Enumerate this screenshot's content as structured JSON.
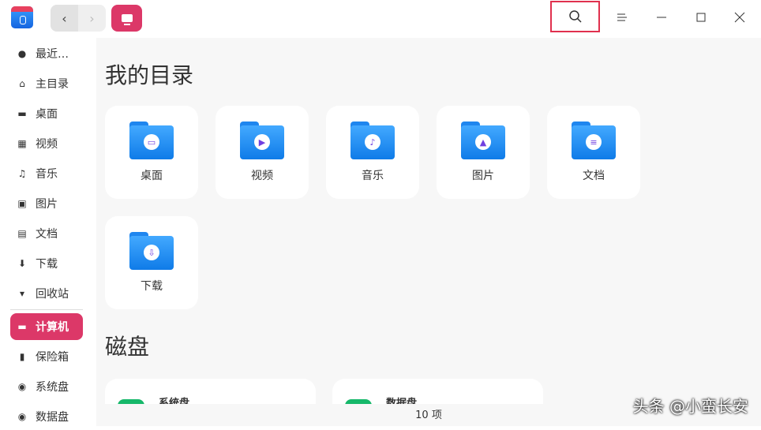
{
  "titlebar": {
    "back": "‹",
    "forward": "›"
  },
  "sidebar": {
    "items": [
      {
        "label": "最近…",
        "icon": "clock-icon",
        "glyph": "●"
      },
      {
        "label": "主目录",
        "icon": "home-icon",
        "glyph": "⌂"
      },
      {
        "label": "桌面",
        "icon": "desktop-icon",
        "glyph": "▬"
      },
      {
        "label": "视频",
        "icon": "video-icon",
        "glyph": "▦"
      },
      {
        "label": "音乐",
        "icon": "music-icon",
        "glyph": "♫"
      },
      {
        "label": "图片",
        "icon": "picture-icon",
        "glyph": "▣"
      },
      {
        "label": "文档",
        "icon": "document-icon",
        "glyph": "▤"
      },
      {
        "label": "下载",
        "icon": "download-icon",
        "glyph": "⬇"
      },
      {
        "label": "回收站",
        "icon": "trash-icon",
        "glyph": "▾"
      },
      {
        "label": "计算机",
        "icon": "computer-icon",
        "glyph": "▬"
      },
      {
        "label": "保险箱",
        "icon": "vault-icon",
        "glyph": "▮"
      },
      {
        "label": "系统盘",
        "icon": "disk-icon",
        "glyph": "◉"
      },
      {
        "label": "数据盘",
        "icon": "disk-icon",
        "glyph": "◉"
      }
    ]
  },
  "main": {
    "section_dirs": "我的目录",
    "folders": [
      {
        "label": "桌面",
        "glyph": "▭"
      },
      {
        "label": "视频",
        "glyph": "▶"
      },
      {
        "label": "音乐",
        "glyph": "♪"
      },
      {
        "label": "图片",
        "glyph": "▲"
      },
      {
        "label": "文档",
        "glyph": "≡"
      },
      {
        "label": "下载",
        "glyph": "⇩"
      }
    ],
    "section_disks": "磁盘",
    "disks": [
      {
        "label": "系统盘"
      },
      {
        "label": "数据盘"
      }
    ]
  },
  "status": {
    "count": "10 项"
  },
  "watermark": "头条 @小蛮长安",
  "colors": {
    "accent": "#dc3868",
    "folder": "#1f86ef",
    "disk": "#16b86a"
  }
}
